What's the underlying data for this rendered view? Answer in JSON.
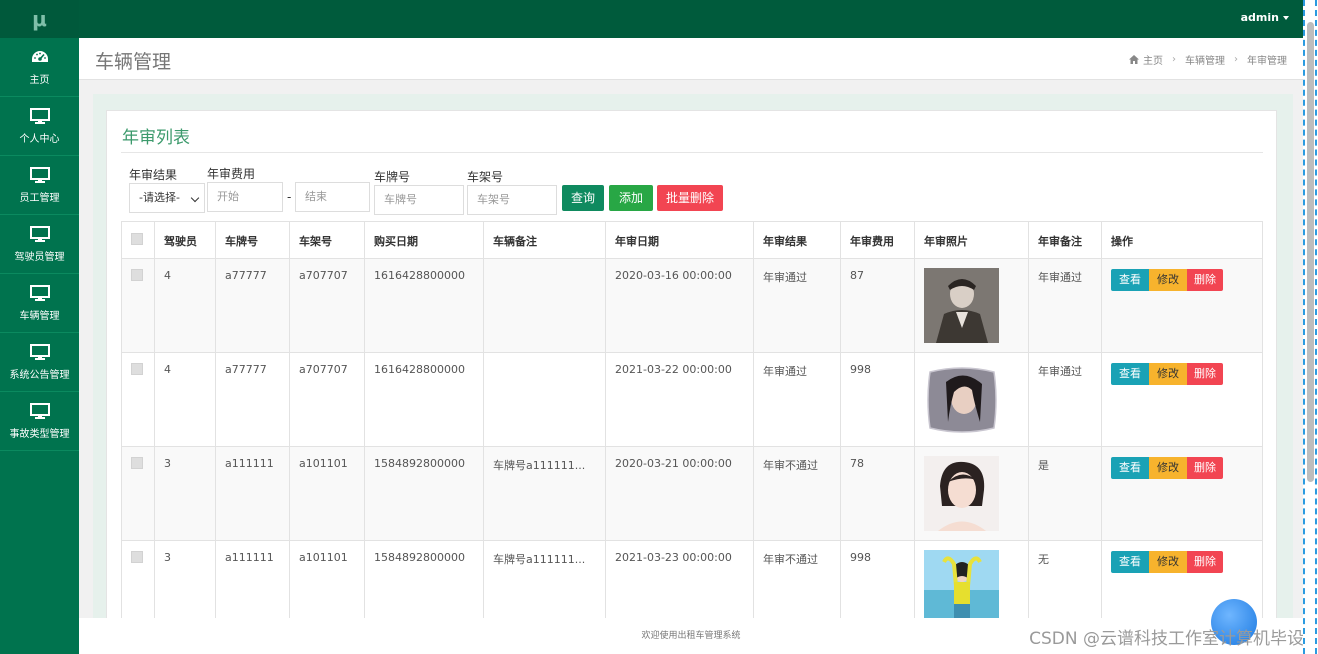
{
  "brand": {
    "logo": "μ"
  },
  "sidebar": {
    "items": [
      {
        "icon": "dashboard-icon",
        "label": "主页"
      },
      {
        "icon": "monitor-icon",
        "label": "个人中心"
      },
      {
        "icon": "monitor-icon",
        "label": "员工管理"
      },
      {
        "icon": "monitor-icon",
        "label": "驾驶员管理"
      },
      {
        "icon": "monitor-icon",
        "label": "车辆管理"
      },
      {
        "icon": "monitor-icon",
        "label": "系统公告管理"
      },
      {
        "icon": "monitor-icon",
        "label": "事故类型管理"
      }
    ]
  },
  "topbar": {
    "user": "admin"
  },
  "header": {
    "title": "车辆管理",
    "breadcrumb": [
      "主页",
      "车辆管理",
      "年审管理"
    ]
  },
  "panel": {
    "title": "年审列表"
  },
  "filters": {
    "result_label": "年审结果",
    "result_value": "-请选择-",
    "fee_label": "年审费用",
    "fee_start_placeholder": "开始",
    "fee_sep": "-",
    "fee_end_placeholder": "结束",
    "plate_label": "车牌号",
    "plate_placeholder": "车牌号",
    "frame_label": "车架号",
    "frame_placeholder": "车架号"
  },
  "buttons": {
    "search": "查询",
    "add": "添加",
    "batch_delete": "批量删除"
  },
  "table": {
    "columns": [
      "驾驶员",
      "车牌号",
      "车架号",
      "购买日期",
      "车辆备注",
      "年审日期",
      "年审结果",
      "年审费用",
      "年审照片",
      "年审备注",
      "操作"
    ],
    "rows": [
      {
        "driver": "4",
        "plate": "a77777",
        "frame": "a707707",
        "buy_date": "1616428800000",
        "note": "",
        "review_date": "2020-03-16 00:00:00",
        "result": "年审通过",
        "fee": "87",
        "photo_icon": "photo-man-icon",
        "remark": "年审通过"
      },
      {
        "driver": "4",
        "plate": "a77777",
        "frame": "a707707",
        "buy_date": "1616428800000",
        "note": "",
        "review_date": "2021-03-22 00:00:00",
        "result": "年审通过",
        "fee": "998",
        "photo_icon": "photo-pillow-icon",
        "remark": "年审通过"
      },
      {
        "driver": "3",
        "plate": "a111111",
        "frame": "a101101",
        "buy_date": "1584892800000",
        "note": "车牌号a111111...",
        "review_date": "2020-03-21 00:00:00",
        "result": "年审不通过",
        "fee": "78",
        "photo_icon": "photo-woman-icon",
        "remark": "是"
      },
      {
        "driver": "3",
        "plate": "a111111",
        "frame": "a101101",
        "buy_date": "1584892800000",
        "note": "车牌号a111111...",
        "review_date": "2021-03-23 00:00:00",
        "result": "年审不通过",
        "fee": "998",
        "photo_icon": "photo-beach-icon",
        "remark": "无"
      }
    ],
    "actions": {
      "view": "查看",
      "edit": "修改",
      "delete": "删除"
    }
  },
  "footer": {
    "text": "欢迎使用出租车管理系统"
  },
  "watermark": "CSDN @云谱科技工作室计算机毕设",
  "colors": {
    "sidebar": "#00734e",
    "topbar": "#005b3c",
    "accent": "#3c9a6c",
    "search_button": "#0f8a5f",
    "add_button": "#28a745",
    "delete_button": "#f24552",
    "view_button": "#1aa2b5",
    "edit_button": "#f7b32d"
  }
}
